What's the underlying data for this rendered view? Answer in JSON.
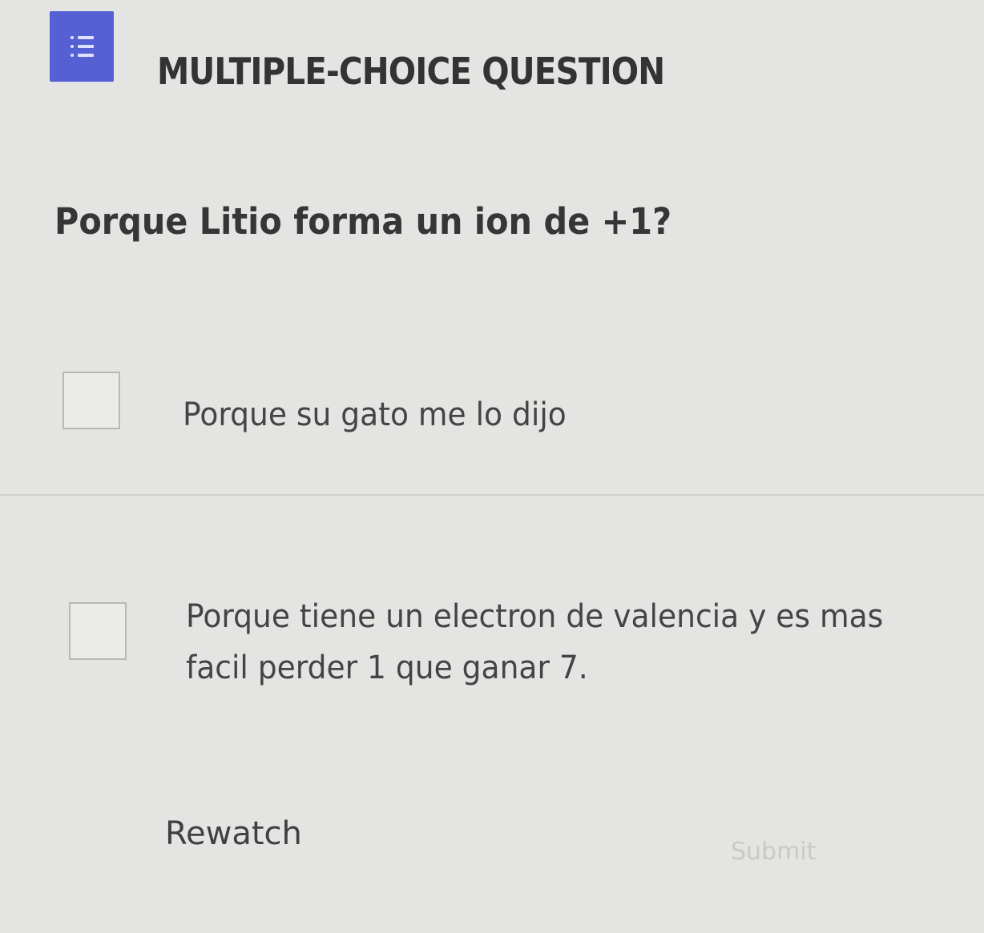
{
  "header": {
    "icon": "list-icon",
    "accent_color": "#5560d4",
    "title": "MULTIPLE-CHOICE QUESTION"
  },
  "question": {
    "text": "Porque Litio forma un ion de +1?"
  },
  "options": [
    {
      "label": "Porque su gato me lo dijo",
      "checked": false
    },
    {
      "label": "Porque tiene un electron de valencia y es mas facil perder 1 que ganar 7.",
      "checked": false
    }
  ],
  "actions": {
    "rewatch_label": "Rewatch",
    "submit_label": "Submit",
    "submit_disabled": true
  }
}
